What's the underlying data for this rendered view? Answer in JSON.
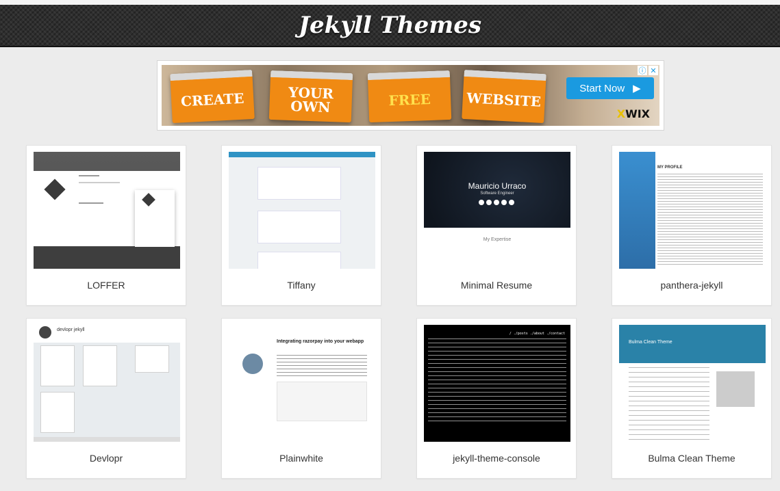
{
  "header": {
    "title": "Jekyll Themes"
  },
  "ad": {
    "windows": [
      "CREATE",
      "YOUR OWN",
      "FREE",
      "WEBSITE"
    ],
    "cta": "Start Now",
    "brand": "WIX",
    "brand_prefix": "X"
  },
  "themes": [
    {
      "name": "LOFFER"
    },
    {
      "name": "Tiffany"
    },
    {
      "name": "Minimal Resume"
    },
    {
      "name": "panthera-jekyll"
    },
    {
      "name": "Devlopr"
    },
    {
      "name": "Plainwhite"
    },
    {
      "name": "jekyll-theme-console"
    },
    {
      "name": "Bulma Clean Theme"
    }
  ],
  "thumbs": {
    "resume_name": "Mauricio Urraco",
    "resume_sub": "Software Engineer",
    "resume_section": "My Expertise",
    "panthera_heading": "MY PROFILE",
    "plain_title": "Integrating razorpay into your webapp",
    "console_nav": "/ ./posts ./about ./contact",
    "bulma_hero": "Bulma Clean Theme",
    "devlopr_title": "devlopr jekyll"
  }
}
